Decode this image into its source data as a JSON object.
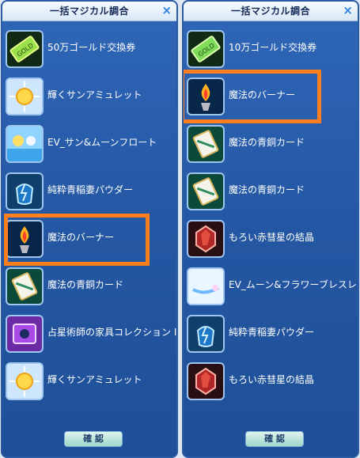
{
  "left_panel": {
    "title": "一括マジカル調合",
    "close": "×",
    "confirm": "確 認",
    "items": [
      {
        "label": "50万ゴールド交換券",
        "icon": "gold-ticket-icon"
      },
      {
        "label": "輝くサンアミュレット",
        "icon": "sun-amulet-icon"
      },
      {
        "label": "EV_サン&ムーンフロート",
        "icon": "sun-moon-float-icon"
      },
      {
        "label": "純粋青稲妻パウダー",
        "icon": "blue-lightning-powder-icon"
      },
      {
        "label": "魔法のバーナー",
        "icon": "magic-burner-icon"
      },
      {
        "label": "魔法の青銅カード",
        "icon": "bronze-card-icon"
      },
      {
        "label": "占星術師の家具コレクション II",
        "icon": "astrologer-furniture-icon"
      },
      {
        "label": "輝くサンアミュレット",
        "icon": "sun-amulet-icon"
      }
    ]
  },
  "right_panel": {
    "title": "一括マジカル調合",
    "close": "×",
    "confirm": "確 認",
    "items": [
      {
        "label": "10万ゴールド交換券",
        "icon": "gold-ticket-icon"
      },
      {
        "label": "魔法のバーナー",
        "icon": "magic-burner-icon"
      },
      {
        "label": "魔法の青銅カード",
        "icon": "bronze-card-icon"
      },
      {
        "label": "魔法の青銅カード",
        "icon": "bronze-card-icon"
      },
      {
        "label": "もろい赤彗星の結晶",
        "icon": "red-comet-crystal-icon"
      },
      {
        "label": "EV_ムーン&フラワーブレスレット_M",
        "icon": "moon-flower-bracelet-icon"
      },
      {
        "label": "純粋青稲妻パウダー",
        "icon": "blue-lightning-powder-icon"
      },
      {
        "label": "もろい赤彗星の結晶",
        "icon": "red-comet-crystal-icon"
      }
    ]
  },
  "colors": {
    "panel": "#2457a3",
    "highlight": "#ff7f1e",
    "label": "#ffffff"
  }
}
